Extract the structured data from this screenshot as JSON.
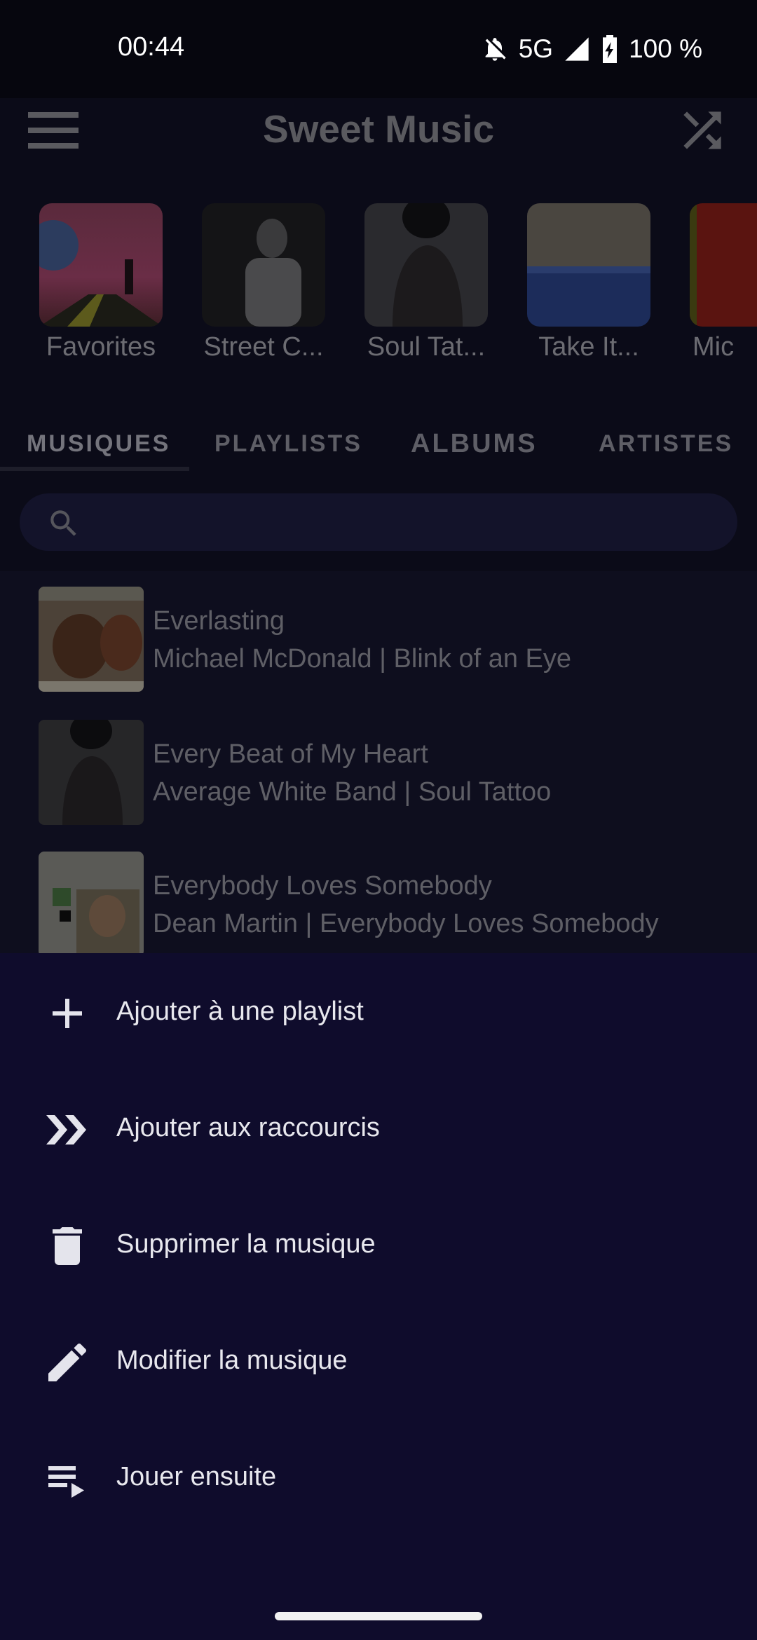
{
  "status_bar": {
    "time": "00:44",
    "network": "5G",
    "battery": "100 %",
    "icons": [
      "bell-off-icon",
      "signal-icon",
      "battery-charging-icon"
    ]
  },
  "header": {
    "title": "Sweet Music",
    "menu_icon": "hamburger-menu-icon",
    "shuffle_icon": "shuffle-icon"
  },
  "shortcuts": [
    {
      "label": "Favorites"
    },
    {
      "label": "Street C..."
    },
    {
      "label": "Soul Tat..."
    },
    {
      "label": "Take It..."
    },
    {
      "label": "Mic"
    }
  ],
  "tabs": [
    {
      "label": "MUSIQUES",
      "active": true
    },
    {
      "label": "PLAYLISTS",
      "active": false
    },
    {
      "label": "ALBUMS",
      "active": false
    },
    {
      "label": "ARTISTES",
      "active": false
    }
  ],
  "search": {
    "placeholder": "",
    "icon": "search-icon"
  },
  "songs": [
    {
      "title": "Everlasting",
      "subtitle": "Michael McDonald | Blink of an Eye"
    },
    {
      "title": "Every Beat of My Heart",
      "subtitle": "Average White Band | Soul Tattoo"
    },
    {
      "title": "Everybody Loves Somebody",
      "subtitle": "Dean Martin | Everybody Loves Somebody"
    }
  ],
  "sheet": {
    "items": [
      {
        "label": "Ajouter à une playlist",
        "icon": "plus-icon"
      },
      {
        "label": "Ajouter aux raccourcis",
        "icon": "double-chevron-right-icon"
      },
      {
        "label": "Supprimer la musique",
        "icon": "trash-icon"
      },
      {
        "label": "Modifier la musique",
        "icon": "pencil-icon"
      },
      {
        "label": "Jouer ensuite",
        "icon": "play-next-queue-icon"
      }
    ]
  },
  "colors": {
    "background": "#0b0b18",
    "sheet": "#0f0c2c",
    "sheet_text": "#e8e8ee",
    "dimmed_text": "#5f5f66"
  }
}
